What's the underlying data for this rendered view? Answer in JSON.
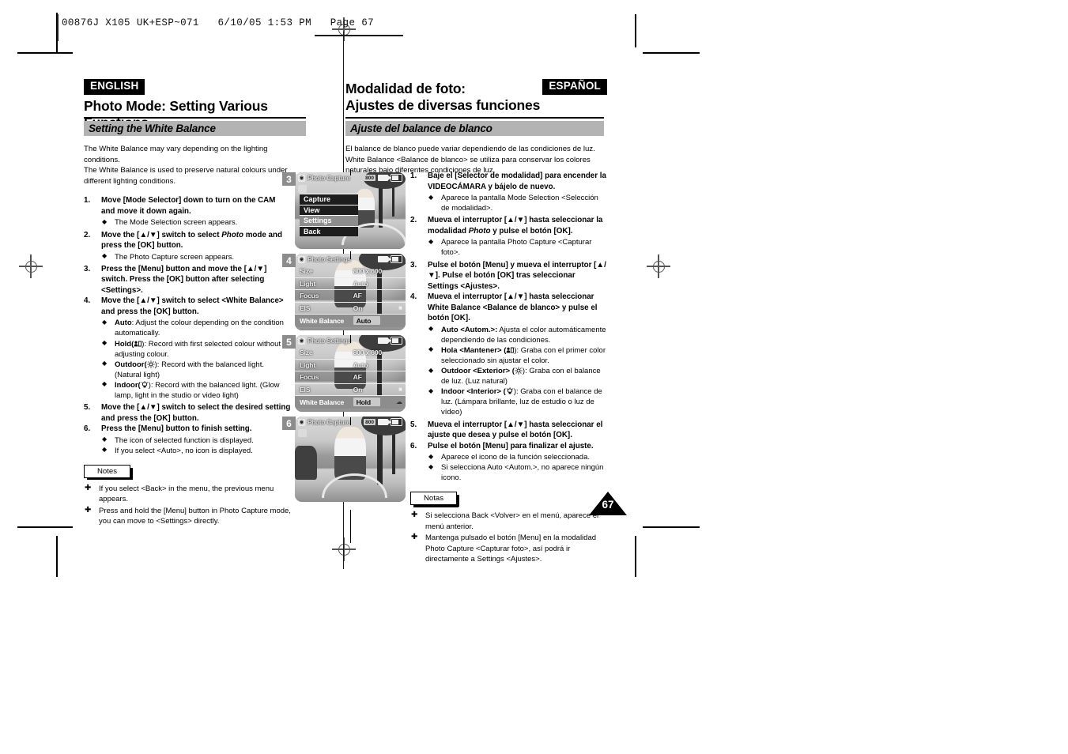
{
  "slug": "00876J X105 UK+ESP~071   6/10/05 1:53 PM   Page 67",
  "english": {
    "tag": "ENGLISH",
    "title": "Photo Mode: Setting Various Functions",
    "section": "Setting the White Balance",
    "intro": [
      "The White Balance may vary depending on the lighting conditions.",
      "The White Balance is used to preserve natural colours under different lighting conditions."
    ],
    "steps": [
      {
        "num": "1.",
        "text": "Move [Mode Selector] down to turn on the CAM and move it down again.",
        "bullets": [
          "The Mode Selection screen appears."
        ]
      },
      {
        "num": "2.",
        "text_a": "Move the [▲/▼] switch to select ",
        "text_em": "Photo",
        "text_b": " mode and press the [OK] button.",
        "bullets": [
          "The Photo Capture screen appears."
        ]
      },
      {
        "num": "3.",
        "text": "Press the [Menu] button and move the [▲/▼] switch. Press the [OK] button after selecting <Settings>.",
        "bullets": []
      },
      {
        "num": "4.",
        "text": "Move the [▲/▼] switch to select <White Balance> and press the [OK] button.",
        "bullets_rich": [
          {
            "lead": "Auto",
            "rest": ": Adjust the colour depending on the condition automatically."
          },
          {
            "lead": "Hold(",
            "icon": "hold-icon",
            "rest": "): Record with first selected colour without adjusting colour."
          },
          {
            "lead": "Outdoor(",
            "icon": "sun-icon",
            "rest": "): Record with the balanced light. (Natural light)"
          },
          {
            "lead": "Indoor(",
            "icon": "bulb-icon",
            "rest": "): Record with the balanced light. (Glow lamp, light in the studio or video light)"
          }
        ]
      },
      {
        "num": "5.",
        "text": "Move the [▲/▼] switch to select the desired setting and press the [OK] button.",
        "bullets": []
      },
      {
        "num": "6.",
        "text": "Press the [Menu] button to finish setting.",
        "bullets": [
          "The icon of selected function is displayed.",
          "If you select <Auto>, no icon is displayed."
        ]
      }
    ],
    "notes_label": "Notes",
    "notes": [
      "If you select <Back> in the menu, the previous menu appears.",
      "Press and hold the [Menu] button in Photo Capture mode, you can move to <Settings> directly."
    ]
  },
  "spanish": {
    "tag": "ESPAÑOL",
    "title_line1": "Modalidad de foto:",
    "title_line2": "Ajustes de diversas funciones",
    "section": "Ajuste del balance de blanco",
    "intro": [
      "El balance de blanco puede variar dependiendo de las condiciones de luz.",
      "White Balance <Balance de blanco> se utiliza para conservar los colores naturales bajo diferentes condiciones de luz."
    ],
    "steps": [
      {
        "num": "1.",
        "text": "Baje el [Selector de modalidad] para encender la VIDEOCÁMARA y bájelo de nuevo.",
        "bullets": [
          "Aparece la pantalla Mode Selection <Selección de modalidad>."
        ]
      },
      {
        "num": "2.",
        "text_a": "Mueva el interruptor [▲/▼] hasta seleccionar la modalidad ",
        "text_em": "Photo",
        "text_b": " y pulse el botón [OK].",
        "bullets": [
          "Aparece la pantalla Photo Capture <Capturar foto>."
        ]
      },
      {
        "num": "3.",
        "text": "Pulse el botón [Menu] y mueva el interruptor [▲/▼]. Pulse el botón [OK] tras seleccionar Settings <Ajustes>.",
        "bullets": []
      },
      {
        "num": "4.",
        "text": "Mueva el interruptor [▲/▼] hasta seleccionar White Balance <Balance de blanco> y pulse el botón [OK].",
        "bullets_rich": [
          {
            "lead": "Auto <Autom.>:",
            "rest": " Ajusta el color automáticamente dependiendo de las condiciones."
          },
          {
            "lead": "Hola <Mantener> (",
            "icon": "hold-icon",
            "rest": "): Graba con el primer color seleccionado sin ajustar el color."
          },
          {
            "lead": "Outdoor <Exterior> (",
            "icon": "sun-icon",
            "rest": "): Graba con el balance de luz. (Luz natural)"
          },
          {
            "lead": "Indoor <Interior> (",
            "icon": "bulb-icon",
            "rest": "): Graba con el balance de luz. (Lámpara brillante, luz de estudio o luz de vídeo)"
          }
        ]
      },
      {
        "num": "5.",
        "text": "Mueva el interruptor [▲/▼] hasta seleccionar el ajuste que desea y pulse el botón [OK].",
        "bullets": []
      },
      {
        "num": "6.",
        "text": "Pulse el botón [Menu] para finalizar el ajuste.",
        "bullets": [
          "Aparece el icono de la función seleccionada.",
          "Si selecciona Auto <Autom.>, no aparece ningún icono."
        ]
      }
    ],
    "notes_label": "Notas",
    "notes": [
      "Si selecciona Back <Volver> en el menú, aparece el menú anterior.",
      "Mantenga pulsado el botón [Menu] en la modalidad Photo Capture <Capturar foto>, así podrá ir directamente a Settings <Ajustes>."
    ]
  },
  "screens": [
    {
      "num": "3",
      "osd_title": "Photo Capture",
      "osd_res": "800",
      "menu": [
        {
          "label": "Capture",
          "selected": false
        },
        {
          "label": "View",
          "selected": false
        },
        {
          "label": "Settings",
          "selected": true
        },
        {
          "label": "Back",
          "selected": false
        }
      ]
    },
    {
      "num": "4",
      "osd_title": "Photo Settings",
      "osd_res": "",
      "rows": [
        {
          "label": "Size",
          "value": "800 x 600",
          "highlight": false
        },
        {
          "label": "Light",
          "value": "Auto",
          "highlight": false
        },
        {
          "label": "Focus",
          "value": "AF",
          "highlight": false
        },
        {
          "label": "EIS",
          "value": "On",
          "highlight": false
        },
        {
          "label": "White Balance",
          "value": "Auto",
          "highlight": true
        }
      ]
    },
    {
      "num": "5",
      "osd_title": "Photo Settings",
      "osd_res": "",
      "rows": [
        {
          "label": "Size",
          "value": "800 x 600",
          "highlight": false
        },
        {
          "label": "Light",
          "value": "Auto",
          "highlight": false
        },
        {
          "label": "Focus",
          "value": "AF",
          "highlight": false
        },
        {
          "label": "EIS",
          "value": "On",
          "highlight": false
        },
        {
          "label": "White Balance",
          "value": "Hold",
          "highlight": true
        }
      ]
    },
    {
      "num": "6",
      "osd_title": "Photo Capture",
      "osd_res": "800",
      "menu": []
    }
  ],
  "page_number": "67"
}
